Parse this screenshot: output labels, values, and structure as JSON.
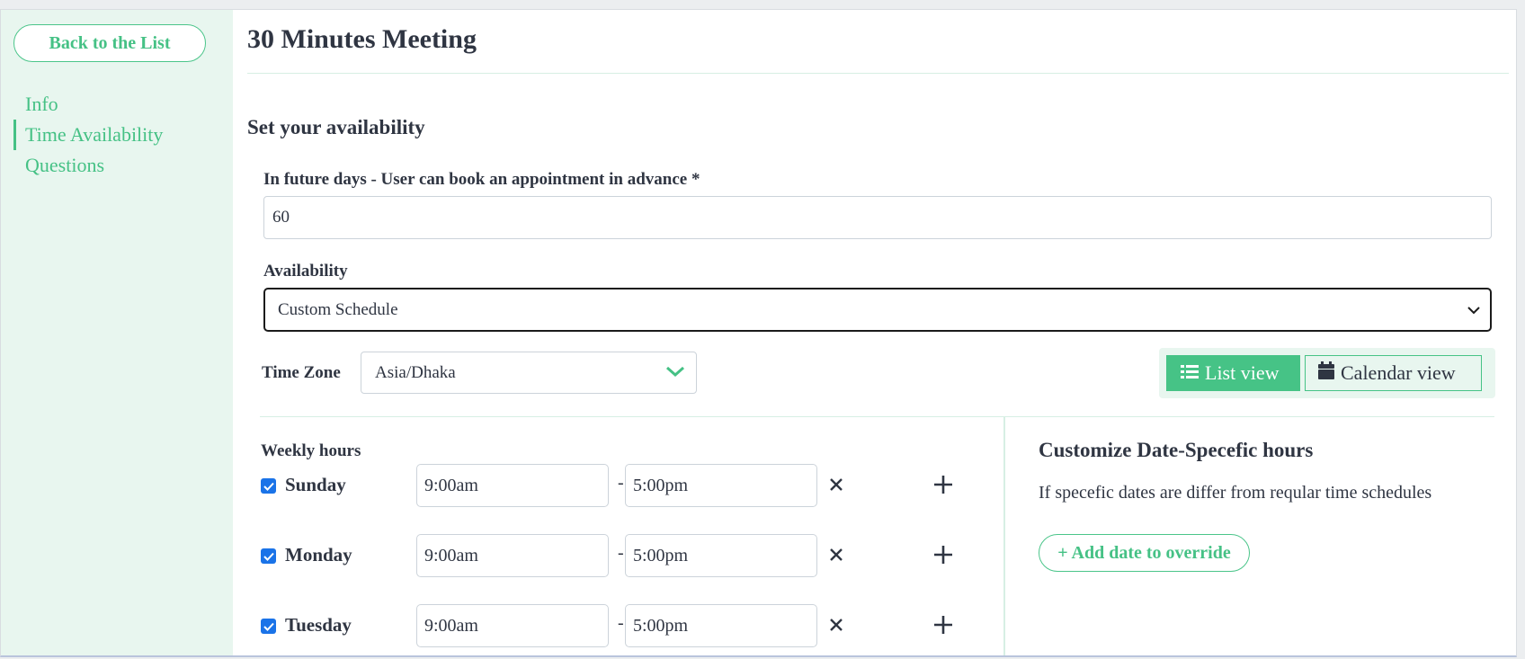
{
  "sidebar": {
    "back_label": "Back to the List",
    "items": [
      {
        "label": "Info"
      },
      {
        "label": "Time Availability"
      },
      {
        "label": "Questions"
      }
    ]
  },
  "page": {
    "title": "30 Minutes Meeting",
    "section_title": "Set your availability"
  },
  "form": {
    "future_days_label": "In future days - User can book an appointment in advance *",
    "future_days_value": "60",
    "availability_label": "Availability",
    "availability_value": "Custom Schedule",
    "timezone_label": "Time Zone",
    "timezone_value": "Asia/Dhaka"
  },
  "views": {
    "list_label": "List view",
    "calendar_label": "Calendar view",
    "active": "list"
  },
  "weekly": {
    "title": "Weekly hours",
    "days": [
      {
        "name": "Sunday",
        "checked": true,
        "start": "9:00am",
        "end": "5:00pm"
      },
      {
        "name": "Monday",
        "checked": true,
        "start": "9:00am",
        "end": "5:00pm"
      },
      {
        "name": "Tuesday",
        "checked": true,
        "start": "9:00am",
        "end": "5:00pm"
      }
    ],
    "separator": "-"
  },
  "date_specific": {
    "title": "Customize Date-Specefic hours",
    "description": "If specefic dates are differ from reqular time schedules",
    "add_label": "+ Add date to override"
  },
  "colors": {
    "accent": "#45c185",
    "sidebar_bg": "#e8f6ef",
    "checkbox": "#1a73e8"
  }
}
